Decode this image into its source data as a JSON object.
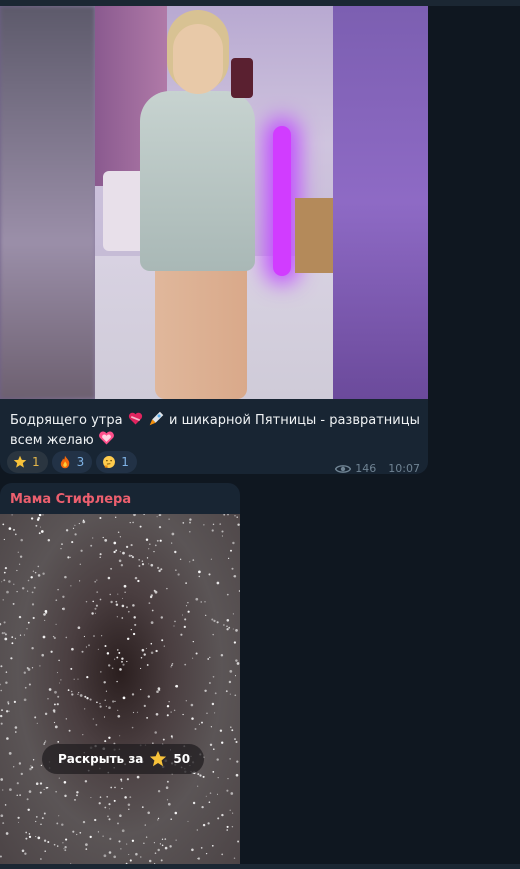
{
  "post": {
    "caption_part1": "Бодрящего утра",
    "caption_part2": "и шикарной Пятницы - развратницы всем желаю",
    "reactions": [
      {
        "emoji": "star",
        "count": "1"
      },
      {
        "emoji": "fire",
        "count": "3"
      },
      {
        "emoji": "thinking",
        "count": "1"
      }
    ],
    "views": "146",
    "time": "10:07"
  },
  "paid_post": {
    "sender": "Мама Стифлера",
    "unlock_label": "Раскрыть за",
    "price": "50"
  },
  "colors": {
    "background": "#0f1720",
    "bubble": "#182533",
    "sender": "#ec5f6e",
    "reaction_accent": "#7fb3e6",
    "meta": "#6f8393"
  },
  "icons": [
    "heart-emoji-icon",
    "rocket-emoji-icon",
    "heart-emoji-icon",
    "star-icon",
    "fire-icon",
    "thinking-face-icon",
    "eye-icon",
    "star-icon"
  ]
}
